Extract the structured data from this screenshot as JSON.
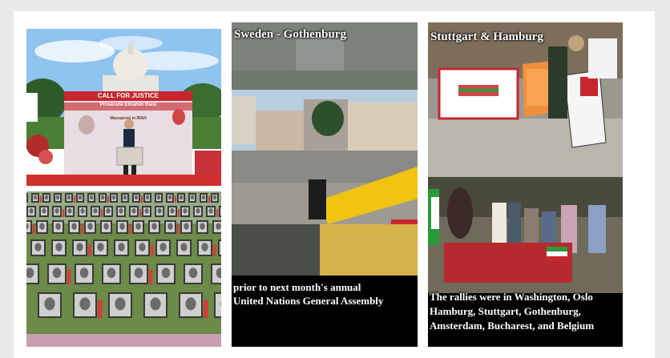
{
  "panels": {
    "washington": {
      "banner_line1": "CALL FOR JUSTICE",
      "banner_line2": "Prosecute Ebrahim Raisi",
      "banner_line3": "Massacred in IRAN"
    },
    "gothenburg": {
      "title": "Sweden - Gothenburg",
      "caption_line1": "prior to next month's annual",
      "caption_line2": "United Nations General Assembly"
    },
    "stuttgart": {
      "title": "Stuttgart & Hamburg",
      "caption_line1": "The rallies were in Washington, Oslo",
      "caption_line2": "Hamburg, Stuttgart, Gothenburg,",
      "caption_line3": "Amsterdam, Bucharest, and Belgium"
    }
  },
  "colors": {
    "page_bg": "#e9e9ea",
    "card_bg": "#ffffff",
    "banner_red": "#c7262e",
    "banner_yellow": "#f1c40f"
  }
}
